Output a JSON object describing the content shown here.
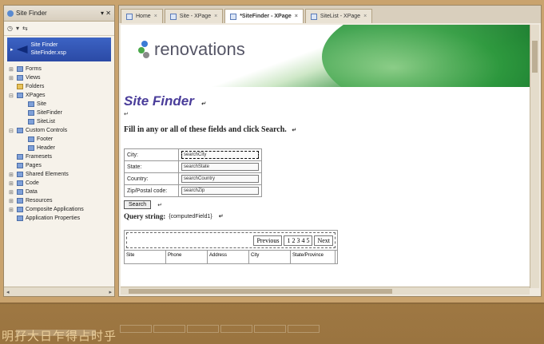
{
  "nav": {
    "title": "Site Finder",
    "selected": {
      "label": "Site Finder",
      "sub": "SiteFinder.xsp"
    },
    "tree": [
      {
        "label": "Forms",
        "exp": "+",
        "icon": "form-icon",
        "indent": 0
      },
      {
        "label": "Views",
        "exp": "+",
        "icon": "view-icon",
        "indent": 0
      },
      {
        "label": "Folders",
        "exp": "",
        "icon": "folder-icon",
        "indent": 0
      },
      {
        "label": "XPages",
        "exp": "-",
        "icon": "xpages-icon",
        "indent": 0
      },
      {
        "label": "Site",
        "exp": "",
        "icon": "xpage-icon",
        "indent": 1
      },
      {
        "label": "SiteFinder",
        "exp": "",
        "icon": "xpage-icon",
        "indent": 1
      },
      {
        "label": "SiteList",
        "exp": "",
        "icon": "xpage-icon",
        "indent": 1
      },
      {
        "label": "Custom Controls",
        "exp": "-",
        "icon": "custom-control-icon",
        "indent": 0
      },
      {
        "label": "Footer",
        "exp": "",
        "icon": "control-icon",
        "indent": 1
      },
      {
        "label": "Header",
        "exp": "",
        "icon": "control-icon",
        "indent": 1
      },
      {
        "label": "Framesets",
        "exp": "",
        "icon": "frameset-icon",
        "indent": 0
      },
      {
        "label": "Pages",
        "exp": "",
        "icon": "page-icon",
        "indent": 0
      },
      {
        "label": "Shared Elements",
        "exp": "+",
        "icon": "shared-icon",
        "indent": 0
      },
      {
        "label": "Code",
        "exp": "+",
        "icon": "code-icon",
        "indent": 0
      },
      {
        "label": "Data",
        "exp": "+",
        "icon": "data-icon",
        "indent": 0
      },
      {
        "label": "Resources",
        "exp": "+",
        "icon": "resources-icon",
        "indent": 0
      },
      {
        "label": "Composite Applications",
        "exp": "+",
        "icon": "composite-icon",
        "indent": 0
      },
      {
        "label": "Application Properties",
        "exp": "",
        "icon": "properties-icon",
        "indent": 0
      }
    ]
  },
  "tabs": [
    {
      "label": "Home",
      "active": false
    },
    {
      "label": "Site - XPage",
      "active": false
    },
    {
      "label": "*SiteFinder - XPage",
      "active": true
    },
    {
      "label": "SiteList - XPage",
      "active": false
    }
  ],
  "page": {
    "logo_text": "renovations",
    "title": "Site Finder",
    "instructions": "Fill in any or all of these fields and click Search.",
    "fields": [
      {
        "label": "City:",
        "value": "searchCity",
        "selected": true
      },
      {
        "label": "State:",
        "value": "searchState",
        "selected": false
      },
      {
        "label": "Country:",
        "value": "searchCountry",
        "selected": false
      },
      {
        "label": "Zip/Postal code:",
        "value": "searchZip",
        "selected": false
      }
    ],
    "search_button": "Search",
    "query_label": "Query string:",
    "query_value": "{computedField1}",
    "pager": [
      "Previous",
      "1 2 3 4 5",
      "Next"
    ],
    "columns": [
      "Site",
      "Phone",
      "Address",
      "City",
      "State/Province"
    ]
  },
  "caption": "明孖大日乍得占时乎"
}
